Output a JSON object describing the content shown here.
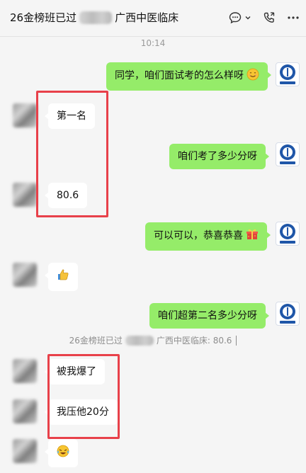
{
  "header": {
    "title_prefix": "26金榜班已过",
    "title_suffix": "广西中医临床",
    "icons": [
      "chat-bubble-icon",
      "chevron-down-icon",
      "phone-icon",
      "more-icon"
    ]
  },
  "timestamp": "10:14",
  "messages": {
    "m1": {
      "text": "同学，咱们面试考的怎么样呀",
      "emoji": "smile"
    },
    "m2": {
      "text": "第一名"
    },
    "m3": {
      "text": "咱们考了多少分呀"
    },
    "m4": {
      "text": "80.6"
    },
    "m5": {
      "text": "可以可以，恭喜恭喜",
      "emoji": "gift"
    },
    "m6": {
      "emoji": "thumbs-up"
    },
    "m7": {
      "text": "咱们超第二名多少分呀"
    },
    "m8": {
      "text": "被我爆了"
    },
    "m9": {
      "text": "我压他20分"
    },
    "m10": {
      "emoji": "laughing-tears"
    }
  },
  "quote_note": {
    "prefix": "26金榜班已过",
    "suffix": "广西中医临床: 80.6"
  },
  "colors": {
    "outgoing_bubble": "#95ec69",
    "incoming_bubble": "#ffffff",
    "highlight_border": "#e8414a",
    "background": "#f5f5f5"
  }
}
